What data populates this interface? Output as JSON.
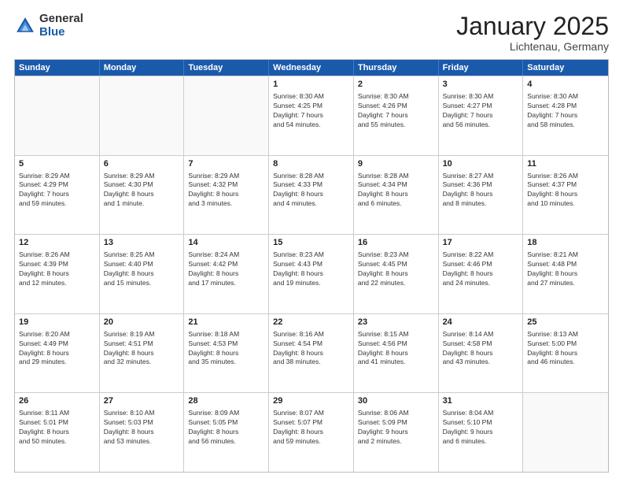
{
  "header": {
    "logo_general": "General",
    "logo_blue": "Blue",
    "month_title": "January 2025",
    "location": "Lichtenau, Germany"
  },
  "weekdays": [
    "Sunday",
    "Monday",
    "Tuesday",
    "Wednesday",
    "Thursday",
    "Friday",
    "Saturday"
  ],
  "rows": [
    [
      {
        "day": "",
        "info": ""
      },
      {
        "day": "",
        "info": ""
      },
      {
        "day": "",
        "info": ""
      },
      {
        "day": "1",
        "info": "Sunrise: 8:30 AM\nSunset: 4:25 PM\nDaylight: 7 hours\nand 54 minutes."
      },
      {
        "day": "2",
        "info": "Sunrise: 8:30 AM\nSunset: 4:26 PM\nDaylight: 7 hours\nand 55 minutes."
      },
      {
        "day": "3",
        "info": "Sunrise: 8:30 AM\nSunset: 4:27 PM\nDaylight: 7 hours\nand 56 minutes."
      },
      {
        "day": "4",
        "info": "Sunrise: 8:30 AM\nSunset: 4:28 PM\nDaylight: 7 hours\nand 58 minutes."
      }
    ],
    [
      {
        "day": "5",
        "info": "Sunrise: 8:29 AM\nSunset: 4:29 PM\nDaylight: 7 hours\nand 59 minutes."
      },
      {
        "day": "6",
        "info": "Sunrise: 8:29 AM\nSunset: 4:30 PM\nDaylight: 8 hours\nand 1 minute."
      },
      {
        "day": "7",
        "info": "Sunrise: 8:29 AM\nSunset: 4:32 PM\nDaylight: 8 hours\nand 3 minutes."
      },
      {
        "day": "8",
        "info": "Sunrise: 8:28 AM\nSunset: 4:33 PM\nDaylight: 8 hours\nand 4 minutes."
      },
      {
        "day": "9",
        "info": "Sunrise: 8:28 AM\nSunset: 4:34 PM\nDaylight: 8 hours\nand 6 minutes."
      },
      {
        "day": "10",
        "info": "Sunrise: 8:27 AM\nSunset: 4:36 PM\nDaylight: 8 hours\nand 8 minutes."
      },
      {
        "day": "11",
        "info": "Sunrise: 8:26 AM\nSunset: 4:37 PM\nDaylight: 8 hours\nand 10 minutes."
      }
    ],
    [
      {
        "day": "12",
        "info": "Sunrise: 8:26 AM\nSunset: 4:39 PM\nDaylight: 8 hours\nand 12 minutes."
      },
      {
        "day": "13",
        "info": "Sunrise: 8:25 AM\nSunset: 4:40 PM\nDaylight: 8 hours\nand 15 minutes."
      },
      {
        "day": "14",
        "info": "Sunrise: 8:24 AM\nSunset: 4:42 PM\nDaylight: 8 hours\nand 17 minutes."
      },
      {
        "day": "15",
        "info": "Sunrise: 8:23 AM\nSunset: 4:43 PM\nDaylight: 8 hours\nand 19 minutes."
      },
      {
        "day": "16",
        "info": "Sunrise: 8:23 AM\nSunset: 4:45 PM\nDaylight: 8 hours\nand 22 minutes."
      },
      {
        "day": "17",
        "info": "Sunrise: 8:22 AM\nSunset: 4:46 PM\nDaylight: 8 hours\nand 24 minutes."
      },
      {
        "day": "18",
        "info": "Sunrise: 8:21 AM\nSunset: 4:48 PM\nDaylight: 8 hours\nand 27 minutes."
      }
    ],
    [
      {
        "day": "19",
        "info": "Sunrise: 8:20 AM\nSunset: 4:49 PM\nDaylight: 8 hours\nand 29 minutes."
      },
      {
        "day": "20",
        "info": "Sunrise: 8:19 AM\nSunset: 4:51 PM\nDaylight: 8 hours\nand 32 minutes."
      },
      {
        "day": "21",
        "info": "Sunrise: 8:18 AM\nSunset: 4:53 PM\nDaylight: 8 hours\nand 35 minutes."
      },
      {
        "day": "22",
        "info": "Sunrise: 8:16 AM\nSunset: 4:54 PM\nDaylight: 8 hours\nand 38 minutes."
      },
      {
        "day": "23",
        "info": "Sunrise: 8:15 AM\nSunset: 4:56 PM\nDaylight: 8 hours\nand 41 minutes."
      },
      {
        "day": "24",
        "info": "Sunrise: 8:14 AM\nSunset: 4:58 PM\nDaylight: 8 hours\nand 43 minutes."
      },
      {
        "day": "25",
        "info": "Sunrise: 8:13 AM\nSunset: 5:00 PM\nDaylight: 8 hours\nand 46 minutes."
      }
    ],
    [
      {
        "day": "26",
        "info": "Sunrise: 8:11 AM\nSunset: 5:01 PM\nDaylight: 8 hours\nand 50 minutes."
      },
      {
        "day": "27",
        "info": "Sunrise: 8:10 AM\nSunset: 5:03 PM\nDaylight: 8 hours\nand 53 minutes."
      },
      {
        "day": "28",
        "info": "Sunrise: 8:09 AM\nSunset: 5:05 PM\nDaylight: 8 hours\nand 56 minutes."
      },
      {
        "day": "29",
        "info": "Sunrise: 8:07 AM\nSunset: 5:07 PM\nDaylight: 8 hours\nand 59 minutes."
      },
      {
        "day": "30",
        "info": "Sunrise: 8:06 AM\nSunset: 5:09 PM\nDaylight: 9 hours\nand 2 minutes."
      },
      {
        "day": "31",
        "info": "Sunrise: 8:04 AM\nSunset: 5:10 PM\nDaylight: 9 hours\nand 6 minutes."
      },
      {
        "day": "",
        "info": ""
      }
    ]
  ]
}
